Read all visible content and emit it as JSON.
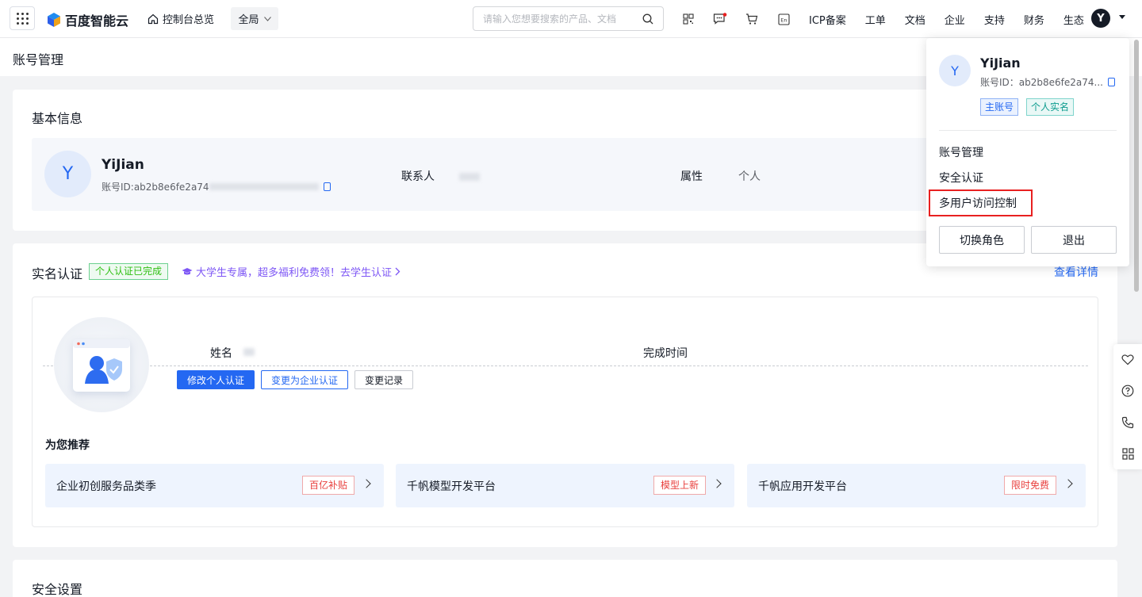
{
  "header": {
    "brand": "百度智能云",
    "overview_label": "控制台总览",
    "scope_label": "全局",
    "search_placeholder": "请输入您想要搜索的产品、文档",
    "links": [
      "ICP备案",
      "工单",
      "文档",
      "企业",
      "支持",
      "财务",
      "生态"
    ],
    "avatar_letter": "Y",
    "accent": "#2468f2"
  },
  "page": {
    "title": "账号管理"
  },
  "basic": {
    "title": "基本信息",
    "avatar_letter": "Y",
    "name": "YiJian",
    "id_label": "账号ID: ",
    "id_value": "ab2b8e6fe2a74",
    "contact_label": "联系人",
    "attr_label": "属性",
    "attr_value": "个人"
  },
  "realname": {
    "title": "实名认证",
    "badge": "个人认证已完成",
    "promo": "大学生专属，超多福利免费领！去学生认证",
    "view_detail": "查看详情",
    "field_name": "姓名",
    "field_done": "完成时间",
    "btn_modify": "修改个人认证",
    "btn_enterprise": "变更为企业认证",
    "btn_history": "变更记录",
    "rec_title": "为您推荐",
    "recommendations": [
      {
        "label": "企业初创服务品类季",
        "tag": "百亿补贴"
      },
      {
        "label": "千帆模型开发平台",
        "tag": "模型上新"
      },
      {
        "label": "千帆应用开发平台",
        "tag": "限时免费"
      }
    ]
  },
  "security": {
    "title": "安全设置"
  },
  "dropdown": {
    "avatar_letter": "Y",
    "name": "YiJian",
    "id_text": "账号ID：ab2b8e6fe2a74...",
    "tag_main": "主账号",
    "tag_personal": "个人实名",
    "menu": [
      "账号管理",
      "安全认证",
      "多用户访问控制"
    ],
    "btn_switch": "切换角色",
    "btn_logout": "退出"
  }
}
